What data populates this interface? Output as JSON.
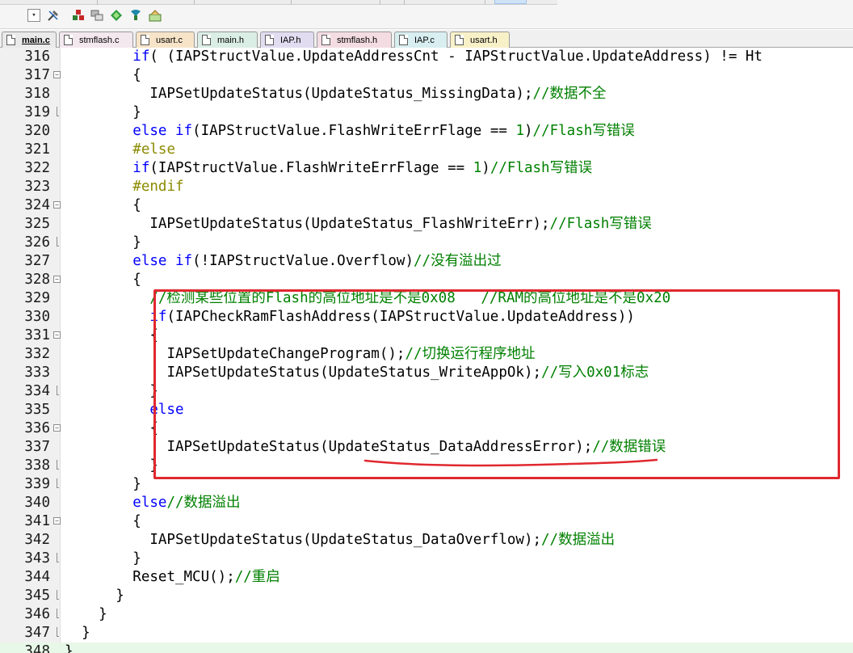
{
  "tabs": [
    {
      "label": "main.c",
      "color": "#eaeaea",
      "active": true
    },
    {
      "label": "stmflash.c",
      "color": "#f3e8ee",
      "active": false
    },
    {
      "label": "usart.c",
      "color": "#f7e4c8",
      "active": false
    },
    {
      "label": "main.h",
      "color": "#dbeee6",
      "active": false
    },
    {
      "label": "IAP.h",
      "color": "#e2dcf1",
      "active": false
    },
    {
      "label": "stmflash.h",
      "color": "#f4dce3",
      "active": false
    },
    {
      "label": "IAP.c",
      "color": "#d8eef0",
      "active": false
    },
    {
      "label": "usart.h",
      "color": "#f8f1c8",
      "active": false
    }
  ],
  "toolbar": {
    "icons": [
      "dropdown-arrow-icon",
      "tools-icon",
      "build-icon",
      "windows-icon",
      "diamond-icon",
      "download-icon",
      "manage-icon"
    ]
  },
  "editor": {
    "lines": [
      {
        "num": "316",
        "fold": "none"
      },
      {
        "num": "317",
        "fold": "open"
      },
      {
        "num": "318",
        "fold": "none"
      },
      {
        "num": "319",
        "fold": "end"
      },
      {
        "num": "320",
        "fold": "none"
      },
      {
        "num": "321",
        "fold": "none"
      },
      {
        "num": "322",
        "fold": "none"
      },
      {
        "num": "323",
        "fold": "none"
      },
      {
        "num": "324",
        "fold": "open"
      },
      {
        "num": "325",
        "fold": "none"
      },
      {
        "num": "326",
        "fold": "end"
      },
      {
        "num": "327",
        "fold": "none"
      },
      {
        "num": "328",
        "fold": "open"
      },
      {
        "num": "329",
        "fold": "none"
      },
      {
        "num": "330",
        "fold": "none"
      },
      {
        "num": "331",
        "fold": "open"
      },
      {
        "num": "332",
        "fold": "none"
      },
      {
        "num": "333",
        "fold": "none"
      },
      {
        "num": "334",
        "fold": "end"
      },
      {
        "num": "335",
        "fold": "none"
      },
      {
        "num": "336",
        "fold": "open"
      },
      {
        "num": "337",
        "fold": "none"
      },
      {
        "num": "338",
        "fold": "end"
      },
      {
        "num": "339",
        "fold": "end"
      },
      {
        "num": "340",
        "fold": "none"
      },
      {
        "num": "341",
        "fold": "open"
      },
      {
        "num": "342",
        "fold": "none"
      },
      {
        "num": "343",
        "fold": "end"
      },
      {
        "num": "344",
        "fold": "none"
      },
      {
        "num": "345",
        "fold": "end"
      },
      {
        "num": "346",
        "fold": "end"
      },
      {
        "num": "347",
        "fold": "end"
      },
      {
        "num": "348",
        "fold": "none"
      }
    ],
    "code": {
      "l316": [
        "if",
        "( (IAPStructValue.UpdateAddressCnt - IAPStructValue.UpdateAddress) != Ht"
      ],
      "l317": "{",
      "l318": [
        "IAPSetUpdateStatus(UpdateStatus_MissingData);",
        "//数据不全"
      ],
      "l319": "}",
      "l320": [
        "else if",
        "(IAPStructValue.FlashWriteErrFlage == ",
        "1",
        ")",
        "//Flash写错误"
      ],
      "l321": "#else",
      "l322": [
        "if",
        "(IAPStructValue.FlashWriteErrFlage == ",
        "1",
        ")",
        "//Flash写错误"
      ],
      "l323": "#endif",
      "l324": "{",
      "l325": [
        "IAPSetUpdateStatus(UpdateStatus_FlashWriteErr);",
        "//Flash写错误"
      ],
      "l326": "}",
      "l327": [
        "else if",
        "(!IAPStructValue.Overflow)",
        "//没有溢出过"
      ],
      "l328": "{",
      "l329": "//检测某些位置的Flash的高位地址是不是0x08   //RAM的高位地址是不是0x20",
      "l330": [
        "if",
        "(IAPCheckRamFlashAddress(IAPStructValue.UpdateAddress))"
      ],
      "l331": "{",
      "l332": [
        "IAPSetUpdateChangeProgram();",
        "//切换运行程序地址"
      ],
      "l333": [
        "IAPSetUpdateStatus(UpdateStatus_WriteAppOk);",
        "//写入0x01标志"
      ],
      "l334": "}",
      "l335": "else",
      "l336": "{",
      "l337": [
        "IAPSetUpdateStatus(UpdateStatus_DataAddressError);",
        "//数据错误"
      ],
      "l338": "}",
      "l339": "}",
      "l340": [
        "else",
        "//数据溢出"
      ],
      "l341": "{",
      "l342": [
        "IAPSetUpdateStatus(UpdateStatus_DataOverflow);",
        "//数据溢出"
      ],
      "l343": "}",
      "l344": [
        "Reset_MCU();",
        "//重启"
      ],
      "l345": "}",
      "l346": "}",
      "l347": "}",
      "l348": "}"
    }
  },
  "annotation": {
    "box_color": "#e0282f"
  }
}
